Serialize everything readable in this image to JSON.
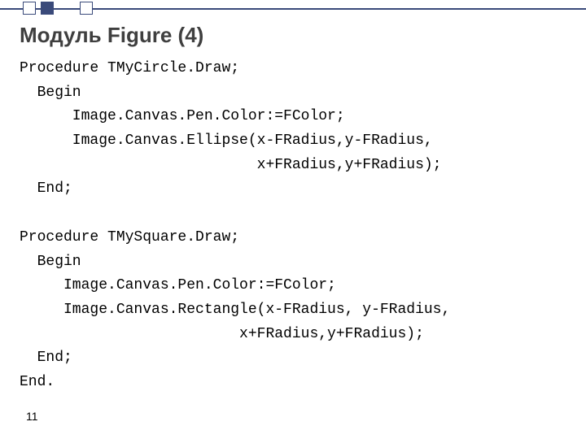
{
  "title": "Модуль Figure (4)",
  "code": "Procedure TMyCircle.Draw;\n  Begin\n      Image.Canvas.Pen.Color:=FColor;\n      Image.Canvas.Ellipse(x-FRadius,y-FRadius,\n                           x+FRadius,y+FRadius);\n  End;\n\nProcedure TMySquare.Draw;\n  Begin\n     Image.Canvas.Pen.Color:=FColor;\n     Image.Canvas.Rectangle(x-FRadius, y-FRadius,\n                         x+FRadius,y+FRadius);\n  End;\nEnd.",
  "page_number": "11"
}
